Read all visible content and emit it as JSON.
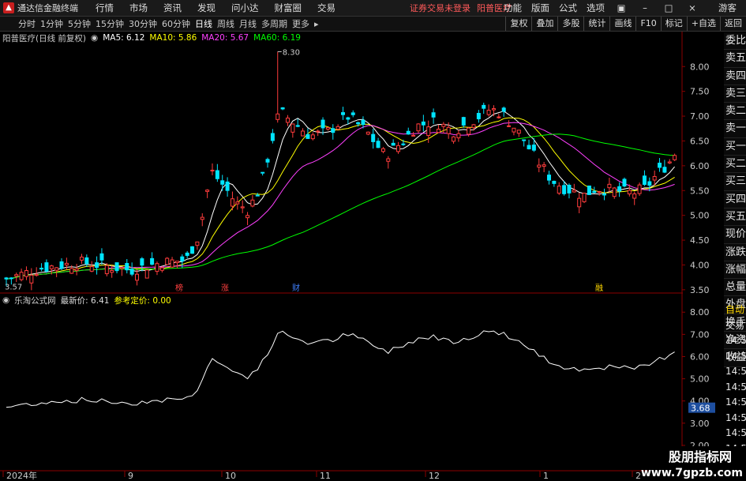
{
  "titlebar": {
    "app_title": "通达信金融终端",
    "menu": [
      "行情",
      "市场",
      "资讯",
      "发现",
      "问小达",
      "财富圈",
      "交易"
    ],
    "notice": "证券交易未登录",
    "stock_name": "阳普医疗",
    "right_menu": [
      "功能",
      "版面",
      "公式",
      "选项"
    ],
    "guest": "游客"
  },
  "toolbar": {
    "periods": [
      "分时",
      "1分钟",
      "5分钟",
      "15分钟",
      "30分钟",
      "60分钟",
      "日线",
      "周线",
      "月线",
      "多周期"
    ],
    "more": "更多",
    "right_tools": [
      "复权",
      "叠加",
      "多股",
      "统计",
      "画线",
      "F10",
      "标记",
      "+自选",
      "返回"
    ]
  },
  "main_legend": {
    "title": "阳普医疗(日线 前复权)",
    "ma5": "MA5: 6.12",
    "ma10": "MA10: 5.86",
    "ma20": "MA20: 5.67",
    "ma60": "MA60: 6.19"
  },
  "sub_legend": {
    "title": "乐淘公式网",
    "latest": "最新价: 6.41",
    "ref": "参考定价: 0.00"
  },
  "main_yaxis": [
    "8.00",
    "7.50",
    "7.00",
    "6.50",
    "6.00",
    "5.50",
    "5.00",
    "4.50",
    "4.00",
    "3.50"
  ],
  "sub_yaxis": [
    "8.00",
    "7.00",
    "6.00",
    "5.00",
    "4.00",
    "3.00",
    "2.00"
  ],
  "xaxis": [
    "2024年",
    "9",
    "10",
    "11",
    "12",
    "1",
    "2"
  ],
  "annotations": {
    "high": "8.30",
    "low": "3.57",
    "current": "3.68"
  },
  "markers": [
    "榜",
    "涨",
    "财",
    "融"
  ],
  "sidebar": [
    "委比",
    "卖五",
    "卖四",
    "卖三",
    "卖二",
    "卖一",
    "买一",
    "买二",
    "买三",
    "买四",
    "买五",
    "现价",
    "涨跌",
    "涨幅",
    "总量",
    "外盘",
    "换手",
    "净资",
    "收益"
  ],
  "sidebar2": [
    "自动",
    "交易",
    "14:56",
    "14:56",
    "14:56",
    "14:56",
    "14:56",
    "14:56",
    "14:56",
    "14:56"
  ],
  "watermark": {
    "line1": "股朋指标网",
    "line2": "www.7gpzb.com"
  },
  "colors": {
    "up": "#ff3c3c",
    "down": "#00e5ff",
    "ma5": "#ffffff",
    "ma10": "#ffff00",
    "ma20": "#ff40ff",
    "ma60": "#00ff00",
    "highlight": "#ffd700"
  }
}
